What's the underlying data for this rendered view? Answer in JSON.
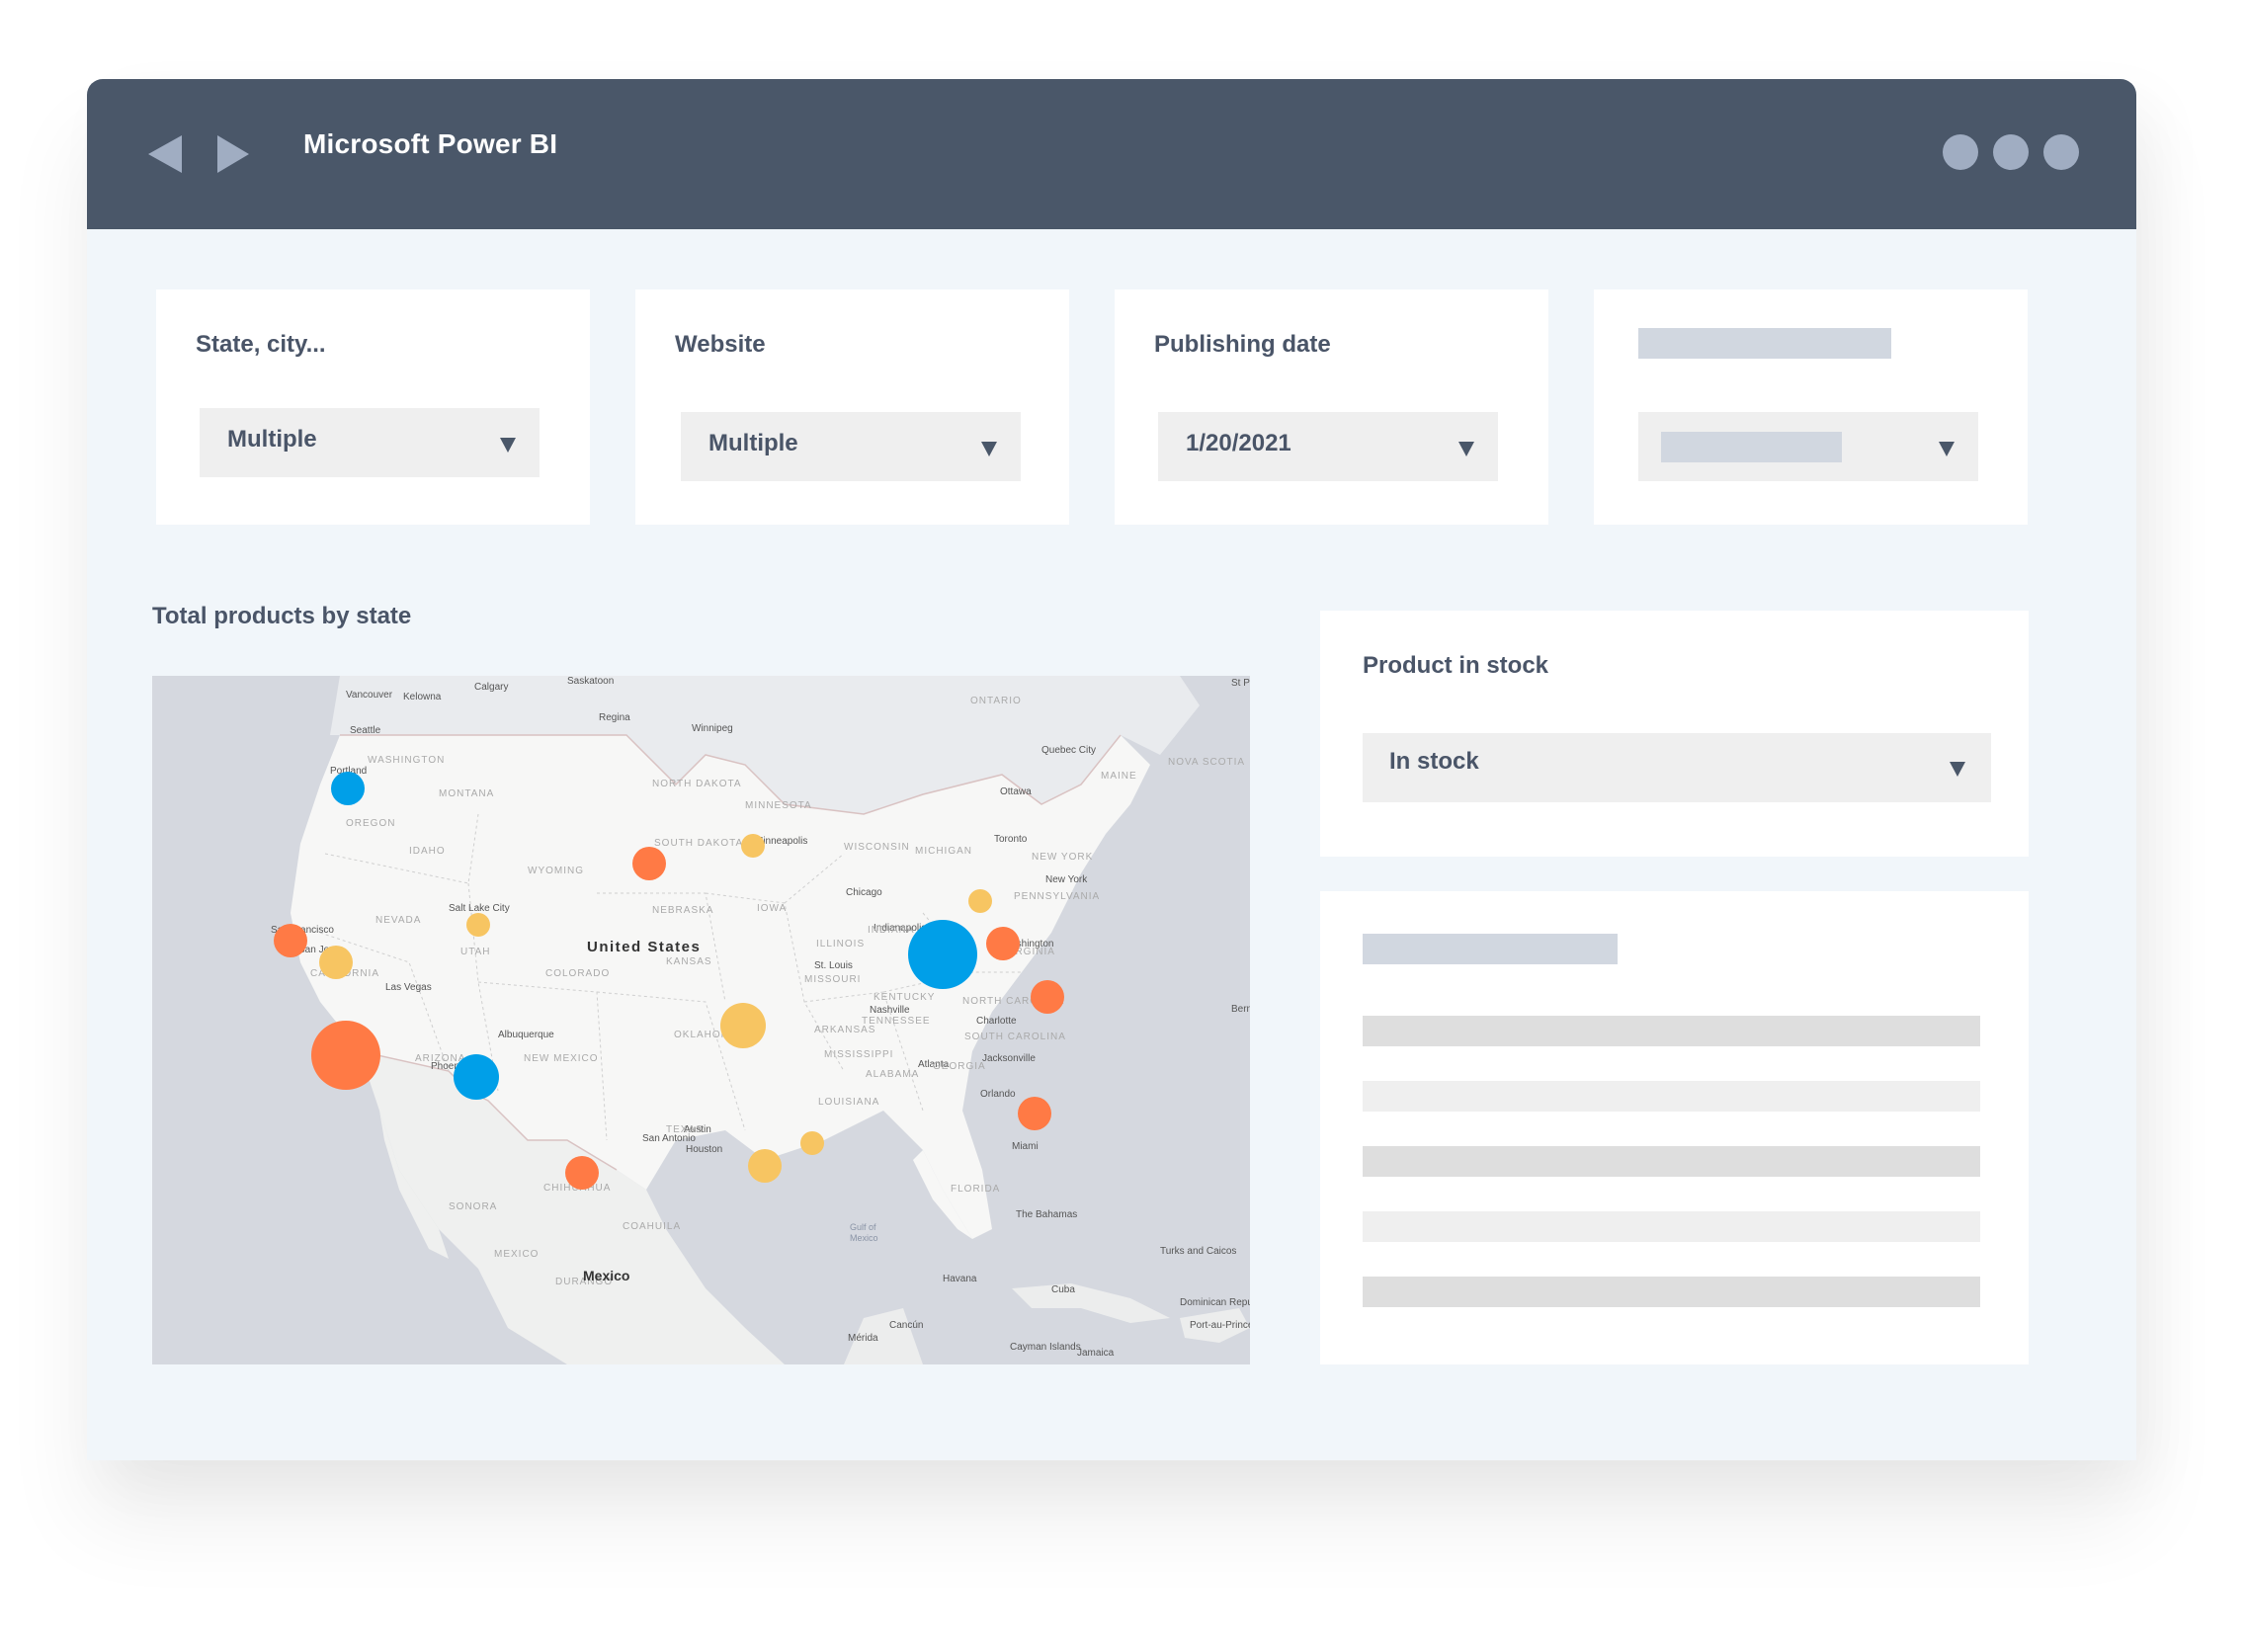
{
  "window": {
    "title": "Microsoft Power BI",
    "nav": {
      "back_icon": "back-arrow-icon",
      "forward_icon": "forward-arrow-icon"
    },
    "menu_icon": "more-dots-icon"
  },
  "filters": [
    {
      "label": "State, city...",
      "value": "Multiple"
    },
    {
      "label": "Website",
      "value": "Multiple"
    },
    {
      "label": "Publishing date",
      "value": "1/20/2021"
    },
    {
      "label": "",
      "value": "",
      "placeholder": true
    }
  ],
  "map_panel": {
    "title": "Total products by state",
    "country_label": "United States",
    "other_labels": [
      "Mexico",
      "Cuba",
      "Gulf of Mexico",
      "Havana",
      "The Bahamas"
    ],
    "colors": {
      "orange": "#ff7a45",
      "yellow": "#f7c562",
      "blue": "#009fe8"
    },
    "bubbles": [
      {
        "place": "Portland",
        "color": "blue",
        "size": "small"
      },
      {
        "place": "San Francisco",
        "color": "orange",
        "size": "small"
      },
      {
        "place": "San Jose",
        "color": "yellow",
        "size": "small"
      },
      {
        "place": "Los Angeles",
        "color": "orange",
        "size": "large"
      },
      {
        "place": "Phoenix",
        "color": "blue",
        "size": "medium"
      },
      {
        "place": "Salt Lake City",
        "color": "yellow",
        "size": "xsmall"
      },
      {
        "place": "South Dakota",
        "color": "orange",
        "size": "small"
      },
      {
        "place": "Minneapolis",
        "color": "yellow",
        "size": "xsmall"
      },
      {
        "place": "Oklahoma",
        "color": "yellow",
        "size": "medium"
      },
      {
        "place": "Chihuahua border",
        "color": "orange",
        "size": "small"
      },
      {
        "place": "Houston",
        "color": "yellow",
        "size": "small"
      },
      {
        "place": "Louisiana",
        "color": "yellow",
        "size": "xsmall"
      },
      {
        "place": "Alabama",
        "color": "orange",
        "size": "small"
      },
      {
        "place": "Ohio/West Virginia",
        "color": "blue",
        "size": "large"
      },
      {
        "place": "Pennsylvania",
        "color": "yellow",
        "size": "xsmall"
      },
      {
        "place": "Washington DC",
        "color": "orange",
        "size": "small"
      },
      {
        "place": "North Carolina coast",
        "color": "orange",
        "size": "small"
      }
    ]
  },
  "stock_panel": {
    "label": "Product in stock",
    "value": "In stock"
  },
  "list_panel": {
    "rows": 5
  }
}
